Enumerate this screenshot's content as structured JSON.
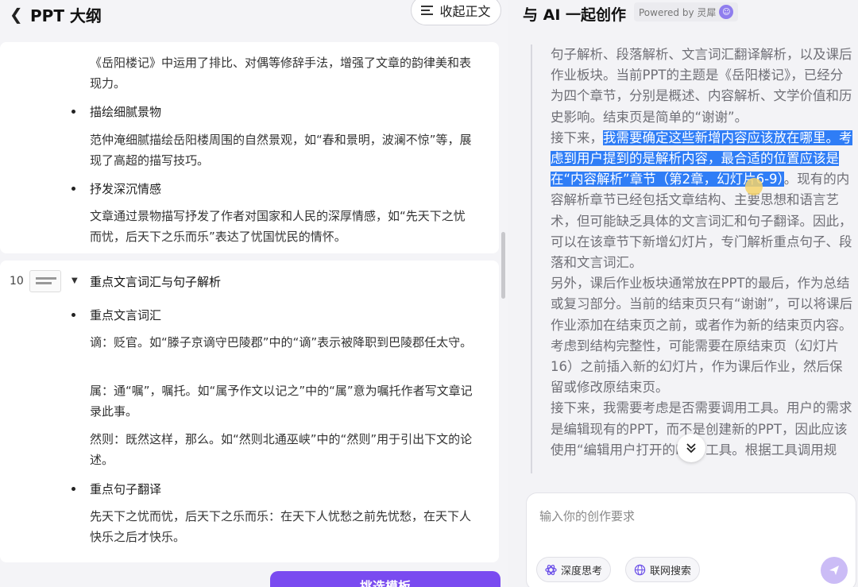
{
  "left": {
    "title": "PPT 大纲",
    "collapse_label": "收起正文",
    "card1": {
      "intro": "《岳阳楼记》中运用了排比、对偶等修辞手法，增强了文章的韵律美和表现力。",
      "bullets": [
        {
          "label": "描绘细腻景物",
          "text": "范仲淹细腻描绘岳阳楼周围的自然景观，如“春和景明，波澜不惊”等，展现了高超的描写技巧。"
        },
        {
          "label": "抒发深沉情感",
          "text": "文章通过景物描写抒发了作者对国家和人民的深厚情感，如“先天下之忧而忧，后天下之乐而乐”表达了忧国忧民的情怀。"
        }
      ]
    },
    "card2": {
      "slide_number": "10",
      "title": "重点文言词汇与句子解析",
      "bullet1": "重点文言词汇",
      "vocab": [
        "谪：贬官。如“滕子京谪守巴陵郡”中的“谪”表示被降职到巴陵郡任太守。",
        "属：通“嘱”，嘱托。如“属予作文以记之”中的“属”意为嘱托作者写文章记录此事。",
        "然则：既然这样，那么。如“然则北通巫峡”中的“然则”用于引出下文的论述。"
      ],
      "bullet2": "重点句子翻译",
      "translation": "先天下之忧而忧，后天下之乐而乐：在天下人忧愁之前先忧愁，在天下人快乐之后才快乐。"
    },
    "next_button": "挑选模板"
  },
  "right": {
    "title": "与 AI 一起创作",
    "powered_by": "Powered by 灵犀",
    "chat": {
      "p1": "句子解析、段落解析、文言词汇翻译解析，以及课后作业板块。当前PPT的主题是《岳阳楼记》，已经分为四个章节，分别是概述、内容解析、文学价值和历史影响。结束页是简单的“谢谢”。",
      "p2_lead": "接下来，",
      "p2_highlight": "我需要确定这些新增内容应该放在哪里。考虑到用户提到的是解析内容，最合适的位置应该是在“内容解析”章节（第2章，幻灯片6-9）",
      "p2_rest": "。现有的内容解析章节已经包括文章结构、主要思想和语言艺术，但可能缺乏具体的文言词汇和句子翻译。因此，可以在该章节下新增幻灯片，专门解析重点句子、段落和文言词汇。",
      "p3": "另外，课后作业板块通常放在PPT的最后，作为总结或复习部分。当前的结束页只有“谢谢”，可以将课后作业添加在结束页之前，或者作为新的结束页内容。考虑到结构完整性，可能需要在原结束页（幻灯片16）之前插入新的幻灯片，作为课后作业，然后保留或修改原结束页。",
      "p4": "接下来，我需要考虑是否需要调用工具。用户的需求是编辑现有的PPT，而不是创建新的PPT，因此应该使用“编辑用户打开的PPT”工具。根据工具调用规"
    },
    "input_placeholder": "输入你的创作要求",
    "chips": [
      "深度思考",
      "联网搜索"
    ]
  }
}
